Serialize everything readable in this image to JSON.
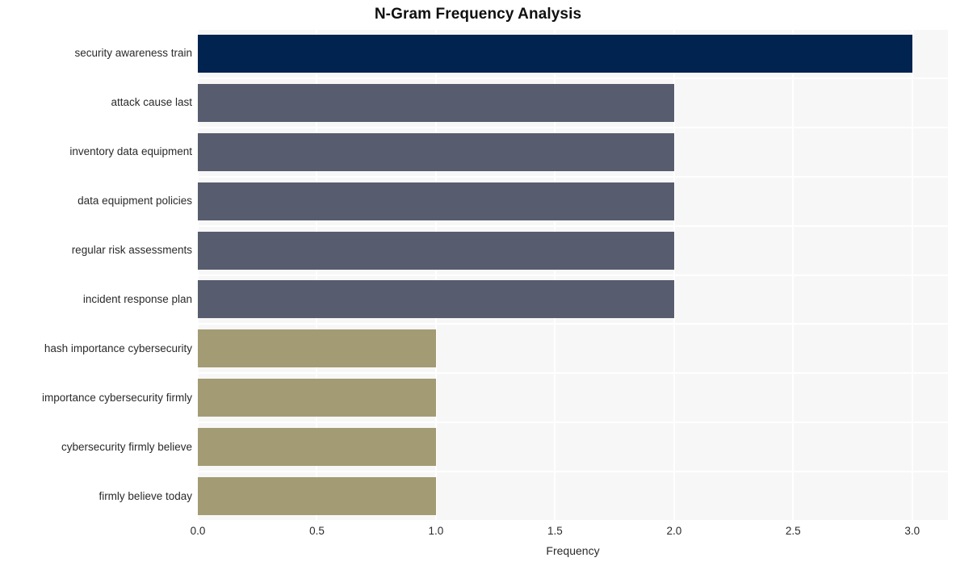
{
  "chart_data": {
    "type": "bar",
    "orientation": "horizontal",
    "title": "N-Gram Frequency Analysis",
    "xlabel": "Frequency",
    "ylabel": "",
    "categories": [
      "security awareness train",
      "attack cause last",
      "inventory data equipment",
      "data equipment policies",
      "regular risk assessments",
      "incident response plan",
      "hash importance cybersecurity",
      "importance cybersecurity firmly",
      "cybersecurity firmly believe",
      "firmly believe today"
    ],
    "values": [
      3,
      2,
      2,
      2,
      2,
      2,
      1,
      1,
      1,
      1
    ],
    "bar_colors": [
      "#01234f",
      "#575d6e",
      "#575d6e",
      "#575d6e",
      "#575d6e",
      "#575d6e",
      "#a39b73",
      "#a39b73",
      "#a39b73",
      "#a39b73"
    ],
    "xlim": [
      0,
      3.15
    ],
    "xticks": [
      0.0,
      0.5,
      1.0,
      1.5,
      2.0,
      2.5,
      3.0
    ],
    "xtick_labels": [
      "0.0",
      "0.5",
      "1.0",
      "1.5",
      "2.0",
      "2.5",
      "3.0"
    ],
    "grid": true,
    "grid_color": "#ffffff",
    "plot_background": "#f7f7f7",
    "figure_background": "#ffffff",
    "legend": null
  }
}
